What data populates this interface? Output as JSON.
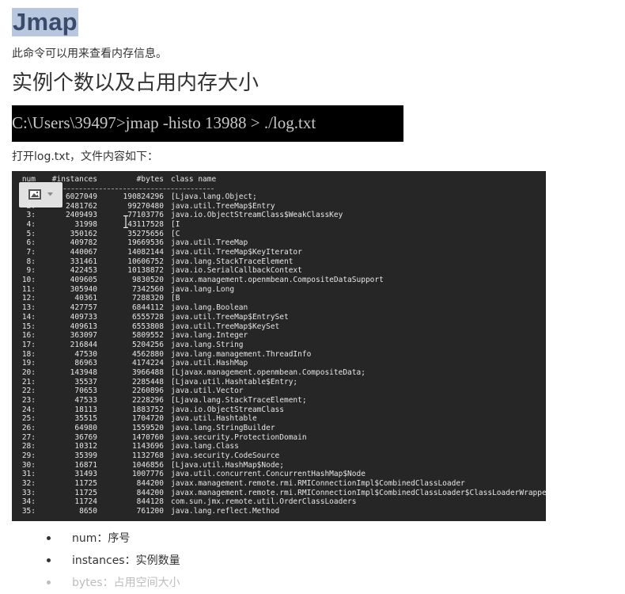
{
  "title": "Jmap",
  "intro": "此命令可以用来查看内存信息。",
  "section_heading": "实例个数以及占用内存大小",
  "command": "C:\\Users\\39497>jmap -histo 13988 > ./log.txt",
  "open_note": "打开log.txt，文件内容如下：",
  "terminal": {
    "header": {
      "num": "num",
      "instances": "#instances",
      "bytes": "#bytes",
      "class_name": "class name"
    },
    "rows": [
      {
        "num": "1:",
        "instances": "6027049",
        "bytes": "190824296",
        "class_name": "[Ljava.lang.Object;"
      },
      {
        "num": "2:",
        "instances": "2481762",
        "bytes": "99270480",
        "class_name": "java.util.TreeMap$Entry"
      },
      {
        "num": "3:",
        "instances": "2409493",
        "bytes": "77103776",
        "class_name": "java.io.ObjectStreamClass$WeakClassKey"
      },
      {
        "num": "4:",
        "instances": "31998",
        "bytes": "43117528",
        "class_name": "[I"
      },
      {
        "num": "5:",
        "instances": "350162",
        "bytes": "35275656",
        "class_name": "[C"
      },
      {
        "num": "6:",
        "instances": "409782",
        "bytes": "19669536",
        "class_name": "java.util.TreeMap"
      },
      {
        "num": "7:",
        "instances": "440067",
        "bytes": "14082144",
        "class_name": "java.util.TreeMap$KeyIterator"
      },
      {
        "num": "8:",
        "instances": "331461",
        "bytes": "10606752",
        "class_name": "java.lang.StackTraceElement"
      },
      {
        "num": "9:",
        "instances": "422453",
        "bytes": "10138872",
        "class_name": "java.io.SerialCallbackContext"
      },
      {
        "num": "10:",
        "instances": "409605",
        "bytes": "9830520",
        "class_name": "javax.management.openmbean.CompositeDataSupport"
      },
      {
        "num": "11:",
        "instances": "305940",
        "bytes": "7342560",
        "class_name": "java.lang.Long"
      },
      {
        "num": "12:",
        "instances": "40361",
        "bytes": "7288320",
        "class_name": "[B"
      },
      {
        "num": "13:",
        "instances": "427757",
        "bytes": "6844112",
        "class_name": "java.lang.Boolean"
      },
      {
        "num": "14:",
        "instances": "409733",
        "bytes": "6555728",
        "class_name": "java.util.TreeMap$EntrySet"
      },
      {
        "num": "15:",
        "instances": "409613",
        "bytes": "6553808",
        "class_name": "java.util.TreeMap$KeySet"
      },
      {
        "num": "16:",
        "instances": "363097",
        "bytes": "5809552",
        "class_name": "java.lang.Integer"
      },
      {
        "num": "17:",
        "instances": "216844",
        "bytes": "5204256",
        "class_name": "java.lang.String"
      },
      {
        "num": "18:",
        "instances": "47530",
        "bytes": "4562880",
        "class_name": "java.lang.management.ThreadInfo"
      },
      {
        "num": "19:",
        "instances": "86963",
        "bytes": "4174224",
        "class_name": "java.util.HashMap"
      },
      {
        "num": "20:",
        "instances": "143948",
        "bytes": "3966488",
        "class_name": "[Ljavax.management.openmbean.CompositeData;"
      },
      {
        "num": "21:",
        "instances": "35537",
        "bytes": "2285448",
        "class_name": "[Ljava.util.Hashtable$Entry;"
      },
      {
        "num": "22:",
        "instances": "70653",
        "bytes": "2260896",
        "class_name": "java.util.Vector"
      },
      {
        "num": "23:",
        "instances": "47533",
        "bytes": "2228296",
        "class_name": "[Ljava.lang.StackTraceElement;"
      },
      {
        "num": "24:",
        "instances": "18113",
        "bytes": "1883752",
        "class_name": "java.io.ObjectStreamClass"
      },
      {
        "num": "25:",
        "instances": "35515",
        "bytes": "1704720",
        "class_name": "java.util.Hashtable"
      },
      {
        "num": "26:",
        "instances": "64980",
        "bytes": "1559520",
        "class_name": "java.lang.StringBuilder"
      },
      {
        "num": "27:",
        "instances": "36769",
        "bytes": "1470760",
        "class_name": "java.security.ProtectionDomain"
      },
      {
        "num": "28:",
        "instances": "10312",
        "bytes": "1143696",
        "class_name": "java.lang.Class"
      },
      {
        "num": "29:",
        "instances": "35399",
        "bytes": "1132768",
        "class_name": "java.security.CodeSource"
      },
      {
        "num": "30:",
        "instances": "16871",
        "bytes": "1046856",
        "class_name": "[Ljava.util.HashMap$Node;"
      },
      {
        "num": "31:",
        "instances": "31493",
        "bytes": "1007776",
        "class_name": "java.util.concurrent.ConcurrentHashMap$Node"
      },
      {
        "num": "32:",
        "instances": "11725",
        "bytes": "844200",
        "class_name": "javax.management.remote.rmi.RMIConnectionImpl$CombinedClassLoader"
      },
      {
        "num": "33:",
        "instances": "11725",
        "bytes": "844200",
        "class_name": "javax.management.remote.rmi.RMIConnectionImpl$CombinedClassLoader$ClassLoaderWrapper"
      },
      {
        "num": "34:",
        "instances": "11724",
        "bytes": "844128",
        "class_name": "com.sun.jmx.remote.util.OrderClassLoaders"
      },
      {
        "num": "35:",
        "instances": "8650",
        "bytes": "761200",
        "class_name": "java.lang.reflect.Method"
      }
    ]
  },
  "image_toolbar": {
    "icon": "image-icon",
    "dropdown_icon": "chevron-down-icon"
  },
  "bullets": [
    "num：序号",
    "instances：实例数量",
    "bytes：占用空间大小"
  ],
  "colors": {
    "title_highlight": "#b9c7de",
    "terminal_bg": "#262626",
    "command_bg": "#000000"
  }
}
